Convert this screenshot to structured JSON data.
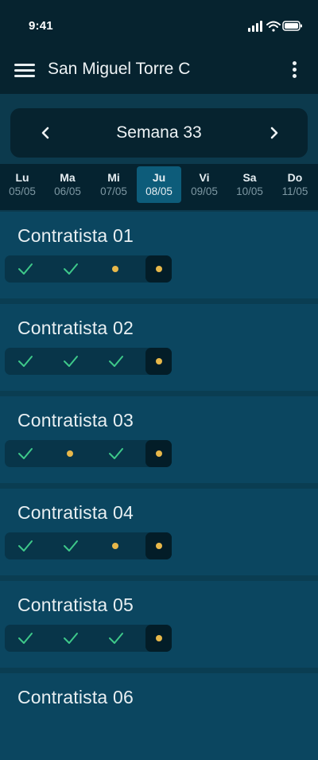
{
  "status_bar": {
    "time": "9:41"
  },
  "app_bar": {
    "title": "San Miguel Torre C"
  },
  "week": {
    "label": "Semana 33",
    "days": [
      {
        "name": "Lu",
        "date": "05/05",
        "active": false
      },
      {
        "name": "Ma",
        "date": "06/05",
        "active": false
      },
      {
        "name": "Mi",
        "date": "07/05",
        "active": false
      },
      {
        "name": "Ju",
        "date": "08/05",
        "active": true
      },
      {
        "name": "Vi",
        "date": "09/05",
        "active": false
      },
      {
        "name": "Sa",
        "date": "10/05",
        "active": false
      },
      {
        "name": "Do",
        "date": "11/05",
        "active": false
      }
    ]
  },
  "colors": {
    "check": "#3ec98a",
    "pending_dot": "#e8b84a"
  },
  "contractors": [
    {
      "name": "Contratista 01",
      "days": [
        "check",
        "check",
        "dot",
        "dot"
      ]
    },
    {
      "name": "Contratista 02",
      "days": [
        "check",
        "check",
        "check",
        "dot"
      ]
    },
    {
      "name": "Contratista 03",
      "days": [
        "check",
        "dot",
        "check",
        "dot"
      ]
    },
    {
      "name": "Contratista 04",
      "days": [
        "check",
        "check",
        "dot",
        "dot"
      ]
    },
    {
      "name": "Contratista 05",
      "days": [
        "check",
        "check",
        "check",
        "dot"
      ]
    },
    {
      "name": "Contratista 06",
      "days": []
    }
  ]
}
